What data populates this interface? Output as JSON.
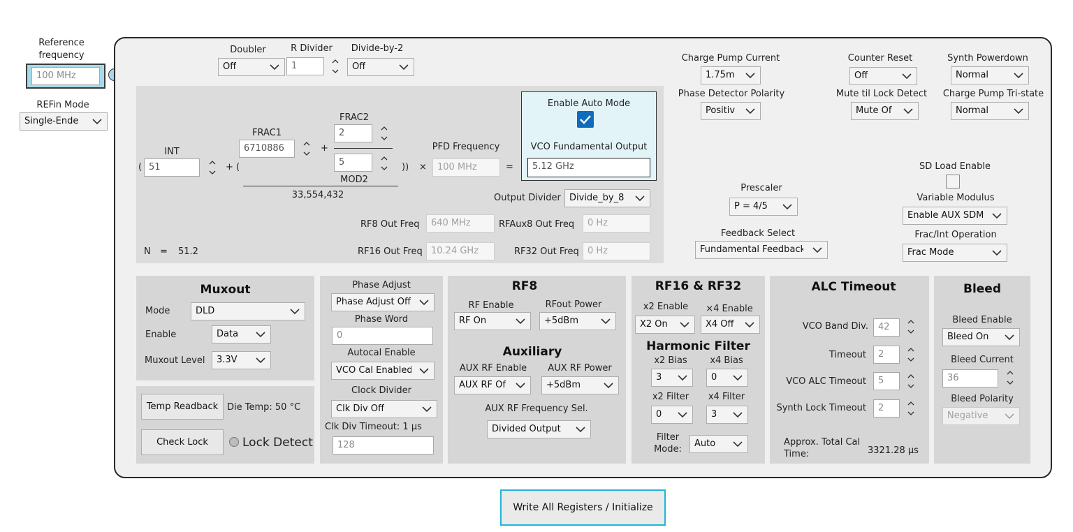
{
  "reference": {
    "label_line1": "Reference",
    "label_line2": "frequency",
    "value": "100 MHz"
  },
  "refin_mode": {
    "label": "REFin Mode",
    "value": "Single-Ende"
  },
  "doubler": {
    "label": "Doubler",
    "value": "Off"
  },
  "r_divider": {
    "label": "R Divider",
    "value": "1"
  },
  "divide_by_2": {
    "label": "Divide-by-2",
    "value": "Off"
  },
  "n_calc": {
    "open1": "(",
    "int_label": "INT",
    "int_value": "51",
    "plus_open": "+ (",
    "frac1_label": "FRAC1",
    "frac1_value": "6710886",
    "plus": "+",
    "frac2_label": "FRAC2",
    "frac2_value": "2",
    "mod2_value": "5",
    "mod2_label": "MOD2",
    "close": "))",
    "times": "×",
    "equals": "=",
    "denominator": "33,554,432",
    "pfd_label": "PFD Frequency",
    "pfd_value": "100 MHz",
    "n_label": "N",
    "n_eq": "=",
    "n_value": "51.2"
  },
  "auto_mode": {
    "label": "Enable Auto Mode",
    "vco_label": "VCO Fundamental Output",
    "vco_value": "5.12 GHz"
  },
  "output_divider": {
    "label": "Output Divider",
    "value": "Divide_by_8"
  },
  "freqs": {
    "rf8_label": "RF8 Out Freq",
    "rf8_value": "640 MHz",
    "rfaux8_label": "RFAux8 Out Freq",
    "rfaux8_value": "0 Hz",
    "rf16_label": "RF16 Out Freq",
    "rf16_value": "10.24 GHz",
    "rf32_label": "RF32 Out Freq",
    "rf32_value": "0 Hz"
  },
  "right_controls": {
    "cp_current_label": "Charge Pump Current",
    "cp_current_value": "1.75m",
    "counter_reset_label": "Counter Reset",
    "counter_reset_value": "Off",
    "synth_pd_label": "Synth Powerdown",
    "synth_pd_value": "Normal",
    "pd_polarity_label": "Phase Detector Polarity",
    "pd_polarity_value": "Positiv",
    "mute_label": "Mute til Lock Detect",
    "mute_value": "Mute Of",
    "cp_tristate_label": "Charge Pump Tri-state",
    "cp_tristate_value": "Normal",
    "sd_load_label": "SD Load Enable",
    "prescaler_label": "Prescaler",
    "prescaler_value": "P = 4/5",
    "var_mod_label": "Variable Modulus",
    "var_mod_value": "Enable AUX SDM",
    "feedback_label": "Feedback Select",
    "feedback_value": "Fundamental Feedback",
    "frac_int_label": "Frac/Int Operation",
    "frac_int_value": "Frac Mode"
  },
  "muxout": {
    "title": "Muxout",
    "mode_label": "Mode",
    "mode_value": "DLD",
    "enable_label": "Enable",
    "enable_value": "Data",
    "level_label": "Muxout Level",
    "level_value": "3.3V"
  },
  "temp": {
    "readback_button": "Temp Readback",
    "die_temp": "Die Temp: 50 °C",
    "check_lock_button": "Check Lock",
    "lock_detect_label": "Lock Detect"
  },
  "phase": {
    "adjust_label": "Phase Adjust",
    "adjust_value": "Phase Adjust Off",
    "word_label": "Phase Word",
    "word_value": "0",
    "autocal_label": "Autocal Enable",
    "autocal_value": "VCO Cal Enabled",
    "clkdiv_label": "Clock Divider",
    "clkdiv_value": "Clk Div Off",
    "clkdiv_timeout_label": "Clk Div Timeout: 1 µs",
    "clkdiv_timeout_value": "128"
  },
  "rf8": {
    "title": "RF8",
    "enable_label": "RF Enable",
    "enable_value": "RF On",
    "power_label": "RFout Power",
    "power_value": "+5dBm",
    "aux_title": "Auxiliary",
    "aux_enable_label": "AUX RF Enable",
    "aux_enable_value": "AUX RF Of",
    "aux_power_label": "AUX RF Power",
    "aux_power_value": "+5dBm",
    "aux_freq_label": "AUX RF Frequency Sel.",
    "aux_freq_value": "Divided Output"
  },
  "rf16": {
    "title": "RF16 & RF32",
    "x2_enable_label": "x2 Enable",
    "x2_enable_value": "X2 On",
    "x4_enable_label": "×4 Enable",
    "x4_enable_value": "X4 Off",
    "harm_title": "Harmonic Filter",
    "x2_bias_label": "x2 Bias",
    "x2_bias_value": "3",
    "x4_bias_label": "x4 Bias",
    "x4_bias_value": "0",
    "x2_filter_label": "x2 Filter",
    "x2_filter_value": "0",
    "x4_filter_label": "x4 Filter",
    "x4_filter_value": "3",
    "filter_mode_label1": "Filter",
    "filter_mode_label2": "Mode:",
    "filter_mode_value": "Auto"
  },
  "alc": {
    "title": "ALC Timeout",
    "vco_band_label": "VCO Band Div.",
    "vco_band_value": "42",
    "timeout_label": "Timeout",
    "timeout_value": "2",
    "vco_alc_label": "VCO ALC Timeout",
    "vco_alc_value": "5",
    "synth_lock_label": "Synth Lock Timeout",
    "synth_lock_value": "2",
    "cal_label1": "Approx. Total Cal",
    "cal_label2": "Time:",
    "cal_value": "3321.28 µs"
  },
  "bleed": {
    "title": "Bleed",
    "enable_label": "Bleed Enable",
    "enable_value": "Bleed On",
    "current_label": "Bleed Current",
    "current_value": "36",
    "polarity_label": "Bleed Polarity",
    "polarity_value": "Negative"
  },
  "write_button": "Write All Registers / Initialize",
  "colors": {
    "accent_cyan": "#21b5d9",
    "checkbox_blue": "#0078d4",
    "panel_gray": "#d6d6d6",
    "container_bg": "#f0f0f0"
  }
}
